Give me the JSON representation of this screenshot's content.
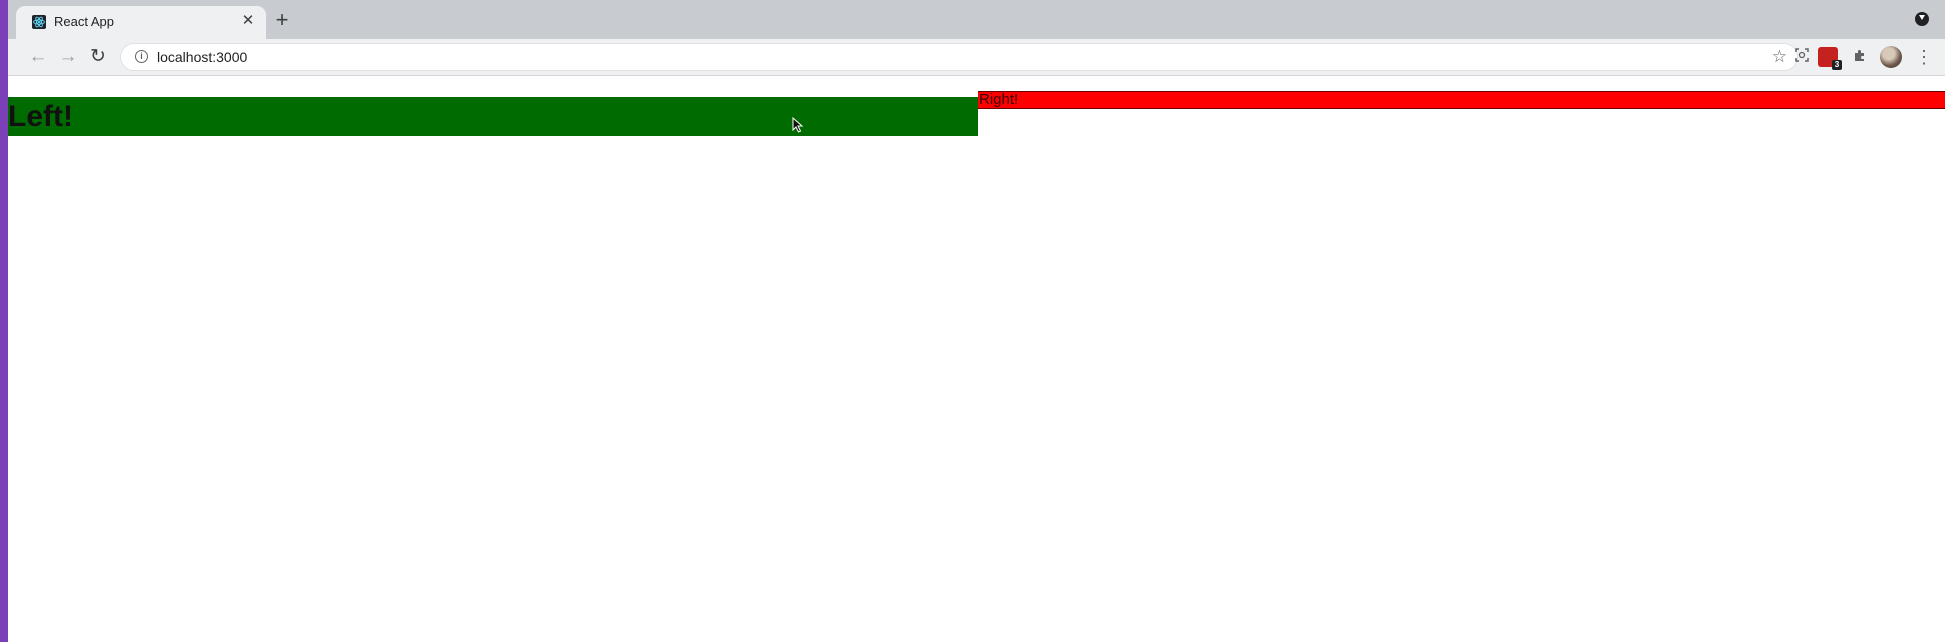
{
  "browser": {
    "tab": {
      "title": "React App",
      "favicon": "react-logo-icon",
      "close_glyph": "✕"
    },
    "new_tab_glyph": "+",
    "nav": {
      "back_glyph": "←",
      "forward_glyph": "→",
      "reload_glyph": "↻"
    },
    "address_bar": {
      "url": "localhost:3000",
      "info_glyph": "i",
      "bookmark_glyph": "☆"
    },
    "extensions": {
      "badge_count": "3",
      "puzzle_glyph": "✱",
      "menu_glyph": "⋮"
    }
  },
  "page": {
    "left_panel": {
      "text": "Left!",
      "color": "#006b00"
    },
    "right_panel": {
      "text": "Right!",
      "color": "#ff0000"
    }
  }
}
